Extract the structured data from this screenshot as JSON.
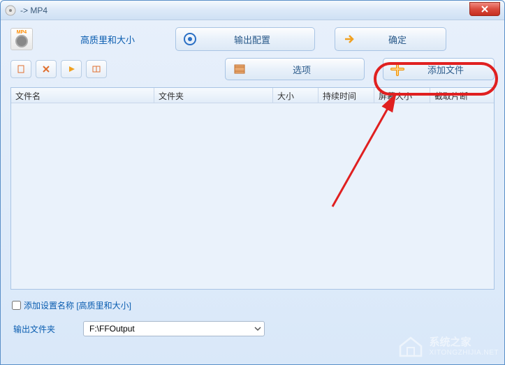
{
  "titlebar": {
    "title": "-> MP4"
  },
  "top": {
    "quality_label": "高质里和大小",
    "output_config": "输出配置",
    "ok": "确定"
  },
  "toolbar": {
    "options": "选项",
    "add_file": "添加文件"
  },
  "table": {
    "headers": {
      "name": "文件名",
      "folder": "文件夹",
      "size": "大小",
      "duration": "持续时间",
      "screen": "屏幕大小",
      "clip": "截取片断"
    }
  },
  "bottom": {
    "add_setting_label": "添加设置名称  [高质里和大小]",
    "output_folder_label": "输出文件夹",
    "output_path": "F:\\FFOutput"
  },
  "watermark": {
    "name": "系统之家",
    "url": "XITONGZHIJIA.NET"
  }
}
